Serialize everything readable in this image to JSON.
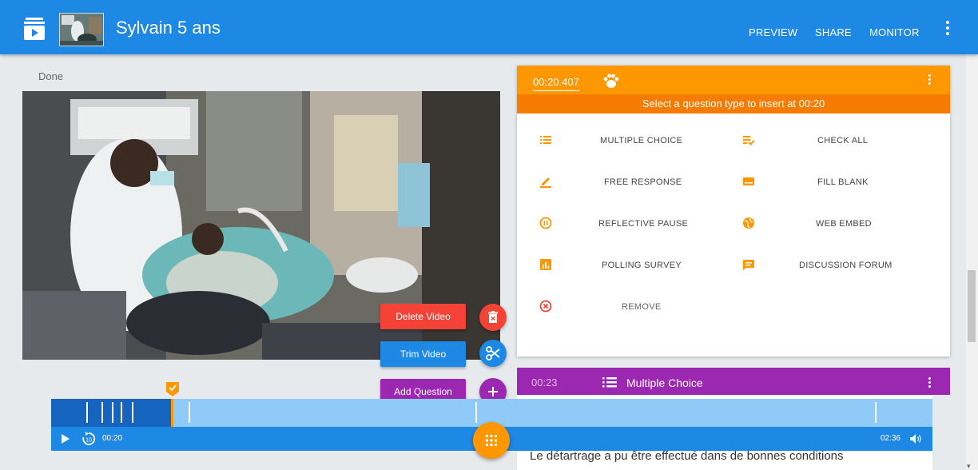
{
  "header": {
    "title": "Sylvain 5 ans",
    "nav": [
      "PREVIEW",
      "SHARE",
      "MONITOR"
    ]
  },
  "status": "Done",
  "question_panel": {
    "time": "00:20.407",
    "prompt": "Select a question type to insert at 00:20",
    "options": [
      {
        "label": "MULTIPLE CHOICE",
        "icon": "list-icon"
      },
      {
        "label": "CHECK ALL",
        "icon": "checklist-icon"
      },
      {
        "label": "FREE RESPONSE",
        "icon": "pencil-icon"
      },
      {
        "label": "FILL BLANK",
        "icon": "fill-blank-icon"
      },
      {
        "label": "REFLECTIVE PAUSE",
        "icon": "pause-circle-icon"
      },
      {
        "label": "WEB EMBED",
        "icon": "globe-icon"
      },
      {
        "label": "POLLING SURVEY",
        "icon": "poll-icon"
      },
      {
        "label": "DISCUSSION FORUM",
        "icon": "forum-icon"
      },
      {
        "label": "REMOVE",
        "icon": "remove-icon"
      }
    ]
  },
  "question_card": {
    "time": "00:23",
    "type": "Multiple Choice",
    "text": "Le détartrage a pu être effectué dans de bonnes conditions"
  },
  "actions": {
    "delete": "Delete Video",
    "trim": "Trim Video",
    "add": "Add Question"
  },
  "player": {
    "current_time": "00:20",
    "duration": "02:36"
  },
  "colors": {
    "header": "#1e88e5",
    "panel_accent": "#ff9800",
    "question_accent": "#9c27b0",
    "delete": "#f44336",
    "trim": "#1e88e5",
    "add": "#9c27b0"
  }
}
